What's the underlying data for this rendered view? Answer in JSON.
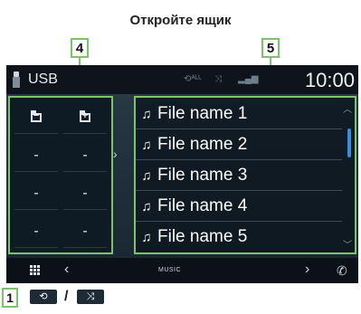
{
  "heading": "Откройте ящик",
  "callouts": {
    "left": "4",
    "right": "5",
    "legend": "1"
  },
  "statusbar": {
    "source": "USB",
    "repeat_icon": "repeat-all-icon",
    "shuffle_icon": "shuffle-icon",
    "signal_icon": "signal-icon",
    "time": "10:00"
  },
  "left_panel": {
    "buttons": [
      {
        "icon": "folder-up-icon",
        "label": ""
      },
      {
        "icon": "folder-down-icon",
        "label": ""
      },
      {
        "label": "-"
      },
      {
        "label": "-"
      },
      {
        "label": "-"
      },
      {
        "label": "-"
      },
      {
        "label": "-"
      },
      {
        "label": "-"
      }
    ]
  },
  "file_list": {
    "items": [
      "File name 1",
      "File name 2",
      "File name 3",
      "File name 4",
      "File name 5"
    ],
    "note_glyph": "♫"
  },
  "bottombar": {
    "source_label": "MUSIC"
  },
  "legend": {
    "repeat_symbol": "⟲",
    "separator": "/",
    "shuffle_symbol": "⤨"
  }
}
